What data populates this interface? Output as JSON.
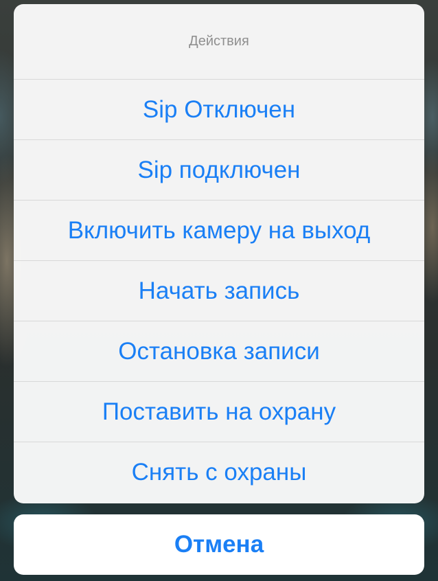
{
  "action_sheet": {
    "title": "Действия",
    "actions": [
      {
        "label": "Sip Отключен"
      },
      {
        "label": "Sip подключен"
      },
      {
        "label": "Включить камеру на выход"
      },
      {
        "label": "Начать запись"
      },
      {
        "label": "Остановка записи"
      },
      {
        "label": "Поставить на охрану"
      },
      {
        "label": "Снять с охраны"
      }
    ],
    "cancel_label": "Отмена"
  },
  "colors": {
    "accent": "#1a7ff5",
    "title_text": "#8f8f8f",
    "sheet_background": "#f7f7f7",
    "separator": "#d8d8d8"
  }
}
